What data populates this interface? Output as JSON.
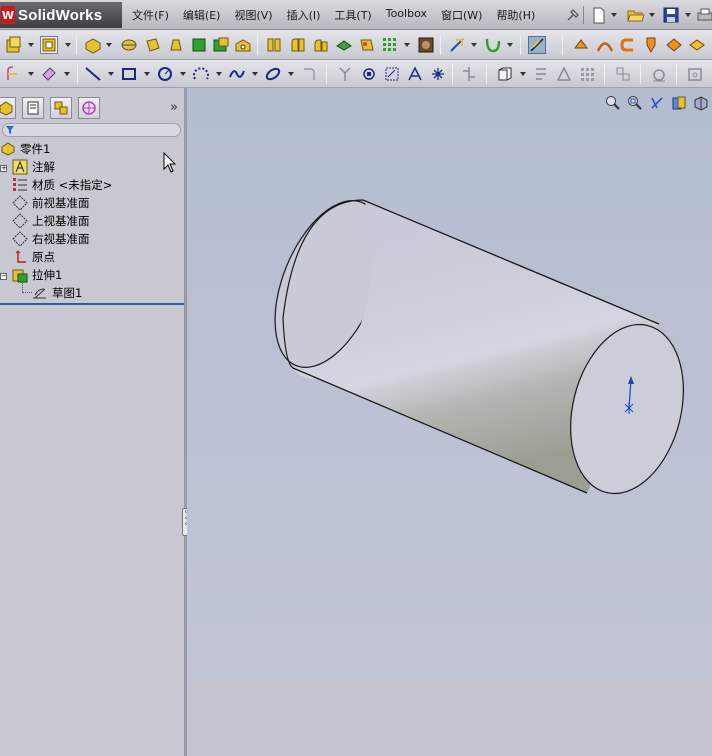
{
  "app": {
    "logo_mark": "W",
    "logo_text": "SolidWorks"
  },
  "menu": [
    {
      "label": "文件(F)"
    },
    {
      "label": "编辑(E)"
    },
    {
      "label": "视图(V)"
    },
    {
      "label": "插入(I)"
    },
    {
      "label": "工具(T)"
    },
    {
      "label": "Toolbox"
    },
    {
      "label": "窗口(W)"
    },
    {
      "label": "帮助(H)"
    }
  ],
  "title_toolbar_icons": [
    "pin-icon",
    "new-document-icon",
    "open-folder-icon",
    "save-icon",
    "print-icon"
  ],
  "toolbar1_icons": [
    "sketch-icon",
    "smart-dimension-icon",
    "extruded-boss-icon",
    "revolved-boss-icon",
    "swept-boss-icon",
    "lofted-boss-icon",
    "boundary-boss-icon",
    "extruded-cut-icon",
    "hole-wizard-icon",
    "revolved-cut-icon",
    "fillet-icon",
    "linear-pattern-icon",
    "rib-icon",
    "draft-icon",
    "shell-icon",
    "wrap-icon",
    "reference-geometry-icon",
    "curves-icon",
    "instant3d-icon",
    "weld-icon",
    "flex-icon",
    "sheetmetal-icon",
    "edge-flange-icon",
    "hem-icon"
  ],
  "toolbar2_icons": [
    "sketch-mode-icon",
    "smart-dim-icon",
    "line-icon",
    "rectangle-icon",
    "circle-icon",
    "arc-icon",
    "spline-icon",
    "ellipse-icon",
    "fillet-sketch-icon",
    "trim-icon",
    "offset-icon",
    "mirror-icon",
    "text-icon",
    "point-icon",
    "linear-sketch-pattern-icon",
    "display-relations-icon",
    "repair-sketch-icon",
    "quick-snaps-icon",
    "rapid-sketch-icon",
    "move-entities-icon",
    "construction-icon"
  ],
  "panel": {
    "tabs": [
      "feature-manager-icon",
      "property-manager-icon",
      "configuration-manager-icon",
      "dim-xpert-icon"
    ],
    "expand_glyph": "»",
    "tree": [
      {
        "label": "零件1",
        "icon": "part-icon",
        "indent": 0,
        "expander": ""
      },
      {
        "label": "注解",
        "icon": "annotations-icon",
        "indent": 1,
        "expander": "+"
      },
      {
        "label": "材质 <未指定>",
        "icon": "material-icon",
        "indent": 1,
        "expander": ""
      },
      {
        "label": "前视基准面",
        "icon": "plane-icon",
        "indent": 1,
        "expander": ""
      },
      {
        "label": "上视基准面",
        "icon": "plane-icon",
        "indent": 1,
        "expander": ""
      },
      {
        "label": "右视基准面",
        "icon": "plane-icon",
        "indent": 1,
        "expander": ""
      },
      {
        "label": "原点",
        "icon": "origin-icon",
        "indent": 1,
        "expander": ""
      },
      {
        "label": "拉伸1",
        "icon": "extrude-feature-icon",
        "indent": 1,
        "expander": "−"
      },
      {
        "label": "草图1",
        "icon": "sketch-node-icon",
        "indent": 2,
        "expander": ""
      }
    ]
  },
  "viewport": {
    "tools": [
      "zoom-to-fit-icon",
      "zoom-area-icon",
      "previous-view-icon",
      "section-view-icon",
      "view-orientation-icon"
    ],
    "model": "cylinder",
    "colors": {
      "body": "#c8cad8",
      "shade": "#a8aa9e",
      "highlight": "#d6d8e4",
      "edge": "#1a1a1a",
      "axis": "#2040c0"
    }
  }
}
